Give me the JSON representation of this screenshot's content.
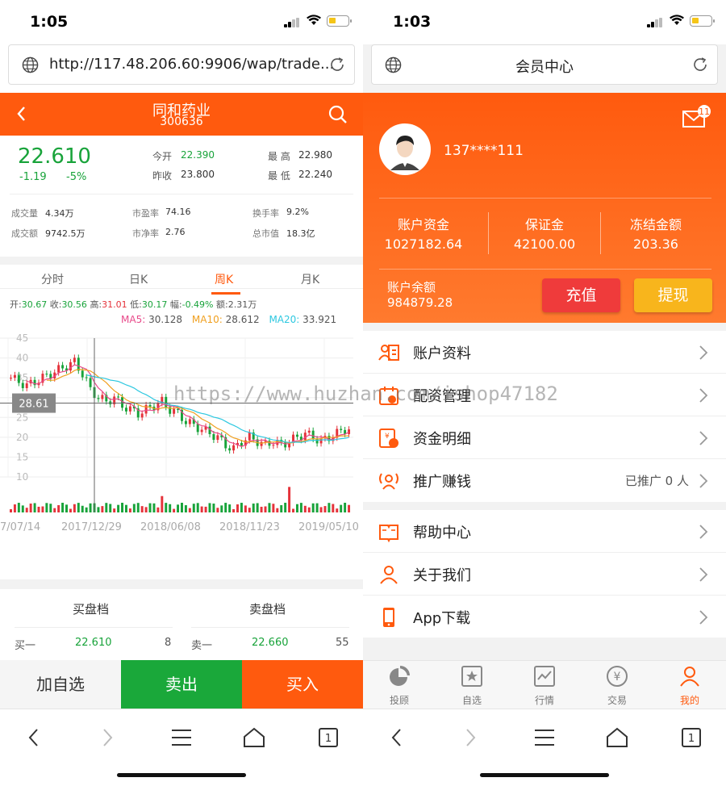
{
  "left": {
    "status": {
      "time": "1:05"
    },
    "url": "http://117.48.206.60:9906/wap/trade...",
    "header": {
      "name": "同和药业",
      "code": "300636"
    },
    "quote": {
      "price": "22.610",
      "change": "-1.19",
      "change_pct": "-5%",
      "open_label": "今开",
      "open": "22.390",
      "prev_label": "昨收",
      "prev": "23.800",
      "high_label": "最 高",
      "high": "22.980",
      "low_label": "最 低",
      "low": "22.240"
    },
    "stats": [
      {
        "label": "成交量",
        "value": "4.34万"
      },
      {
        "label": "市盈率",
        "value": "74.16"
      },
      {
        "label": "换手率",
        "value": "9.2%"
      },
      {
        "label": "成交额",
        "value": "9742.5万"
      },
      {
        "label": "市净率",
        "value": "2.76"
      },
      {
        "label": "总市值",
        "value": "18.3亿"
      }
    ],
    "tabs": [
      "分时",
      "日K",
      "周K",
      "月K"
    ],
    "active_tab": "周K",
    "ohlc": {
      "open_label": "开:",
      "open": "30.67",
      "close_label": "收:",
      "close": "30.56",
      "high_label": "高:",
      "high": "31.01",
      "low_label": "低:",
      "low": "30.17",
      "amp_label": "幅:",
      "amp": "-0.49%",
      "amt_label": "额:",
      "amt": "2.31万"
    },
    "ma": {
      "ma5_label": "MA5:",
      "ma5": "30.128",
      "ma10_label": "MA10:",
      "ma10": "28.612",
      "ma20_label": "MA20:",
      "ma20": "33.921"
    },
    "chart_data": {
      "type": "line",
      "yticks": [
        "45",
        "40",
        "35",
        "30",
        "25",
        "20",
        "15",
        "10"
      ],
      "ylim": [
        10,
        45
      ],
      "xticks": [
        "7/07/14",
        "2017/12/29",
        "2018/06/08",
        "2018/11/23",
        "2019/05/10"
      ],
      "crosshair_value": "28.61",
      "series": [
        {
          "values": [
            35,
            34,
            33,
            34,
            35,
            36,
            37,
            38,
            39,
            36,
            32,
            30,
            29,
            30,
            28,
            27,
            26,
            27,
            28,
            29,
            27,
            26,
            24,
            23,
            22,
            21,
            20,
            18,
            17,
            19,
            20,
            19,
            18,
            19,
            18,
            19,
            20,
            21,
            20,
            19,
            20,
            21,
            22
          ]
        }
      ]
    },
    "book": {
      "buy_title": "买盘档",
      "sell_title": "卖盘档",
      "buy1_label": "买一",
      "buy1_price": "22.610",
      "buy1_vol": "8",
      "sell1_label": "卖一",
      "sell1_price": "22.660",
      "sell1_vol": "55"
    },
    "actions": {
      "watch": "加自选",
      "sell": "卖出",
      "buy": "买入"
    },
    "colors": {
      "accent": "#ff5a0e",
      "up": "#e5323a",
      "down": "#18a33a",
      "ma5": "#e84a8a",
      "ma10": "#f0a020",
      "ma20": "#2ec8e0"
    }
  },
  "right": {
    "status": {
      "time": "1:03"
    },
    "url": "会员中心",
    "mail_badge": "11",
    "phone": "137****111",
    "funds": [
      {
        "label": "账户资金",
        "value": "1027182.64"
      },
      {
        "label": "保证金",
        "value": "42100.00"
      },
      {
        "label": "冻结金额",
        "value": "203.36"
      }
    ],
    "balance_label": "账户余额",
    "balance": "984879.28",
    "recharge": "充值",
    "withdraw": "提现",
    "menu1": [
      {
        "label": "账户资料",
        "icon": "profile-icon"
      },
      {
        "label": "配资管理",
        "icon": "calendar-icon"
      },
      {
        "label": "资金明细",
        "icon": "money-detail-icon"
      },
      {
        "label": "推广赚钱",
        "icon": "broadcast-icon",
        "extra": "已推广 0 人"
      }
    ],
    "menu2": [
      {
        "label": "帮助中心",
        "icon": "book-icon"
      },
      {
        "label": "关于我们",
        "icon": "people-icon"
      },
      {
        "label": "App下载",
        "icon": "phone-icon"
      }
    ],
    "tabbar": [
      {
        "label": "投顾",
        "icon": "pie-icon"
      },
      {
        "label": "自选",
        "icon": "star-icon"
      },
      {
        "label": "行情",
        "icon": "chart-icon"
      },
      {
        "label": "交易",
        "icon": "yen-icon"
      },
      {
        "label": "我的",
        "icon": "user-icon"
      }
    ]
  },
  "watermark": "https://www.huzhan.com/ishop47182"
}
